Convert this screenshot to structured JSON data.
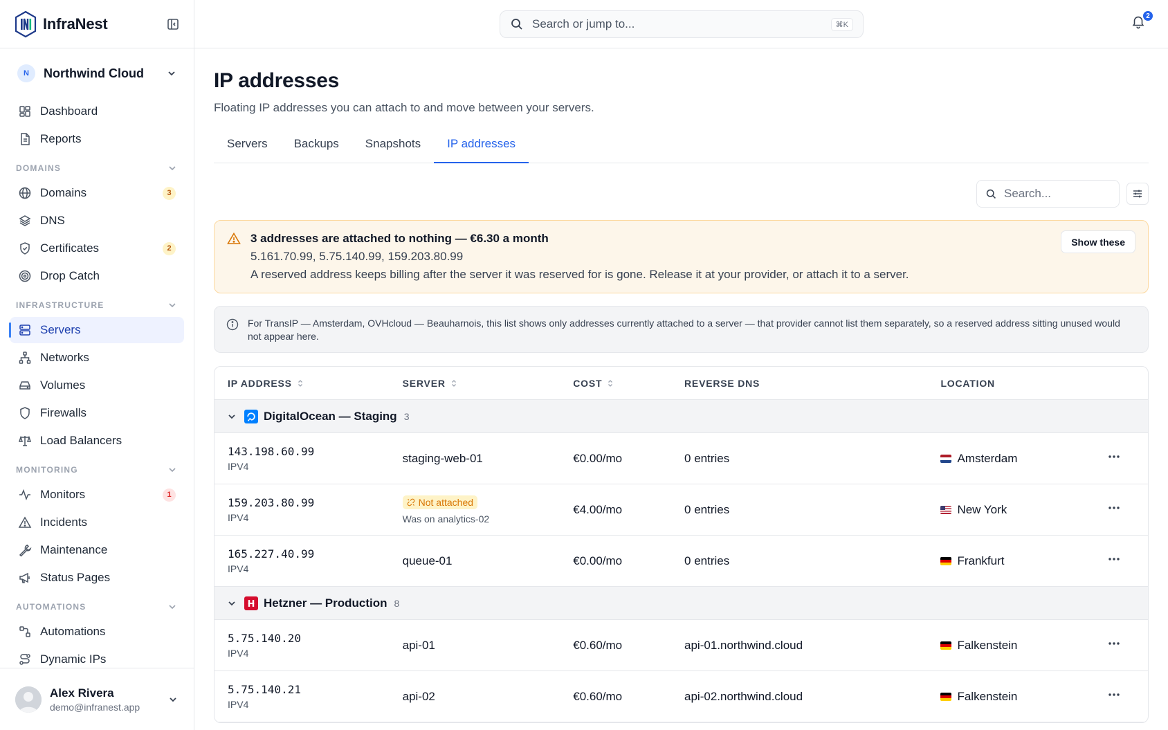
{
  "brand": {
    "name": "InfraNest"
  },
  "org": {
    "initial": "N",
    "name": "Northwind Cloud"
  },
  "nav": {
    "top": [
      {
        "label": "Dashboard",
        "icon": "dashboard-icon"
      },
      {
        "label": "Reports",
        "icon": "reports-icon"
      }
    ],
    "domains": {
      "heading": "DOMAINS",
      "items": [
        {
          "label": "Domains",
          "badge": "3"
        },
        {
          "label": "DNS"
        },
        {
          "label": "Certificates",
          "badge": "2"
        },
        {
          "label": "Drop Catch"
        }
      ]
    },
    "infrastructure": {
      "heading": "INFRASTRUCTURE",
      "items": [
        {
          "label": "Servers"
        },
        {
          "label": "Networks"
        },
        {
          "label": "Volumes"
        },
        {
          "label": "Firewalls"
        },
        {
          "label": "Load Balancers"
        }
      ]
    },
    "monitoring": {
      "heading": "MONITORING",
      "items": [
        {
          "label": "Monitors",
          "badge": "1"
        },
        {
          "label": "Incidents"
        },
        {
          "label": "Maintenance"
        },
        {
          "label": "Status Pages"
        }
      ]
    },
    "automations": {
      "heading": "AUTOMATIONS",
      "items": [
        {
          "label": "Automations"
        },
        {
          "label": "Dynamic IPs"
        }
      ]
    }
  },
  "user": {
    "name": "Alex Rivera",
    "email": "demo@infranest.app"
  },
  "topbar": {
    "search_placeholder": "Search or jump to...",
    "shortcut": "⌘K",
    "notifications": "2"
  },
  "page": {
    "title": "IP addresses",
    "subtitle": "Floating IP addresses you can attach to and move between your servers.",
    "tabs": [
      "Servers",
      "Backups",
      "Snapshots",
      "IP addresses"
    ],
    "active_tab": "IP addresses",
    "search_placeholder": "Search..."
  },
  "warning": {
    "title": "3 addresses are attached to nothing — €6.30 a month",
    "ips": "5.161.70.99, 5.75.140.99, 159.203.80.99",
    "note": "A reserved address keeps billing after the server it was reserved for is gone. Release it at your provider, or attach it to a server.",
    "button": "Show these"
  },
  "info": "For TransIP — Amsterdam, OVHcloud — Beauharnois, this list shows only addresses currently attached to a server — that provider cannot list them separately, so a reserved address sitting unused would not appear here.",
  "table": {
    "headers": [
      "IP ADDRESS",
      "SERVER",
      "COST",
      "REVERSE DNS",
      "LOCATION"
    ],
    "groups": [
      {
        "name": "DigitalOcean — Staging",
        "count": "3",
        "rows": [
          {
            "ip": "143.198.60.99",
            "kind": "IPV4",
            "server": "staging-web-01",
            "cost": "€0.00/mo",
            "rdns": "0 entries",
            "location": "Amsterdam",
            "flag": "nl"
          },
          {
            "ip": "159.203.80.99",
            "kind": "IPV4",
            "status": "Not attached",
            "was": "Was on analytics-02",
            "cost": "€4.00/mo",
            "rdns": "0 entries",
            "location": "New York",
            "flag": "us"
          },
          {
            "ip": "165.227.40.99",
            "kind": "IPV4",
            "server": "queue-01",
            "cost": "€0.00/mo",
            "rdns": "0 entries",
            "location": "Frankfurt",
            "flag": "de"
          }
        ]
      },
      {
        "name": "Hetzner — Production",
        "count": "8",
        "rows": [
          {
            "ip": "5.75.140.20",
            "kind": "IPV4",
            "server": "api-01",
            "cost": "€0.60/mo",
            "rdns": "api-01.northwind.cloud",
            "location": "Falkenstein",
            "flag": "de"
          },
          {
            "ip": "5.75.140.21",
            "kind": "IPV4",
            "server": "api-02",
            "cost": "€0.60/mo",
            "rdns": "api-02.northwind.cloud",
            "location": "Falkenstein",
            "flag": "de"
          }
        ]
      }
    ]
  }
}
